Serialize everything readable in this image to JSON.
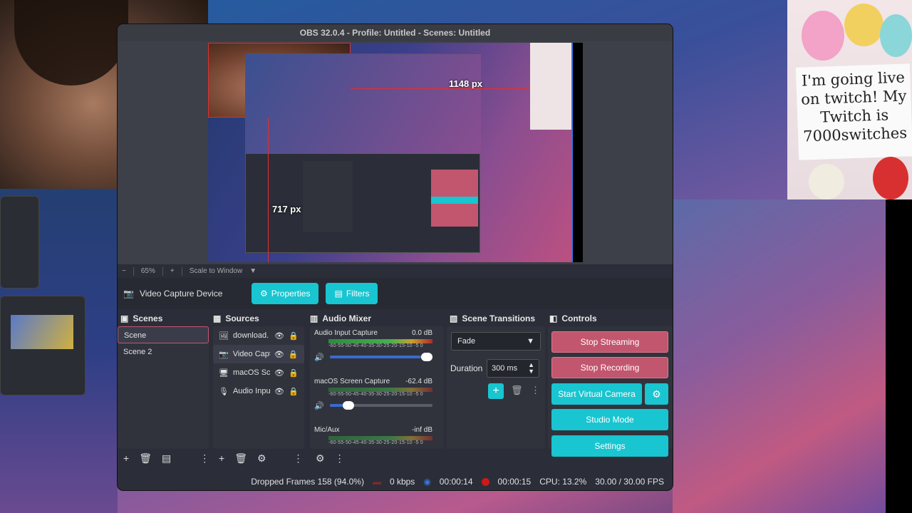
{
  "window": {
    "title": "OBS 32.0.4 - Profile: Untitled - Scenes: Untitled"
  },
  "preview": {
    "width_label": "1148 px",
    "height_label": "717 px"
  },
  "zoom": {
    "minus": "−",
    "level": "65%",
    "plus": "+",
    "mode": "Scale to Window"
  },
  "source_bar": {
    "device": "Video Capture Device",
    "properties": "Properties",
    "filters": "Filters"
  },
  "scenes": {
    "title": "Scenes",
    "items": [
      "Scene",
      "Scene 2"
    ],
    "selected": "Scene"
  },
  "sources": {
    "title": "Sources",
    "items": [
      {
        "name": "download.",
        "icon": "image-icon"
      },
      {
        "name": "Video Capt",
        "icon": "camera-icon"
      },
      {
        "name": "macOS Scr",
        "icon": "monitor-icon"
      },
      {
        "name": "Audio Inpu",
        "icon": "microphone-icon"
      }
    ]
  },
  "mixer": {
    "title": "Audio Mixer",
    "scale": "-60-55-50-45-40-35-30-25-20-15-10 -5  0",
    "channels": [
      {
        "name": "Audio Input Capture",
        "db": "0.0 dB",
        "volume": 1.0
      },
      {
        "name": "macOS Screen Capture",
        "db": "-62.4 dB",
        "volume": 0.28
      },
      {
        "name": "Mic/Aux",
        "db": "-inf dB",
        "volume": 0.0
      }
    ]
  },
  "transitions": {
    "title": "Scene Transitions",
    "selected": "Fade",
    "duration_label": "Duration",
    "duration_value": "300 ms"
  },
  "controls": {
    "title": "Controls",
    "stop_streaming": "Stop Streaming",
    "stop_recording": "Stop Recording",
    "virtual_camera": "Start Virtual Camera",
    "studio_mode": "Studio Mode",
    "settings": "Settings"
  },
  "status": {
    "dropped": "Dropped Frames 158 (94.0%)",
    "bitrate": "0 kbps",
    "stream_time": "00:00:14",
    "rec_time": "00:00:15",
    "cpu": "CPU: 13.2%",
    "fps": "30.00 / 30.00 FPS"
  },
  "overlay_sign": "I'm going live on twitch! My Twitch is 7000switches",
  "colors": {
    "accent_cyan": "#18c5d0",
    "accent_pink": "#c2566e",
    "record_red": "#d01818"
  }
}
